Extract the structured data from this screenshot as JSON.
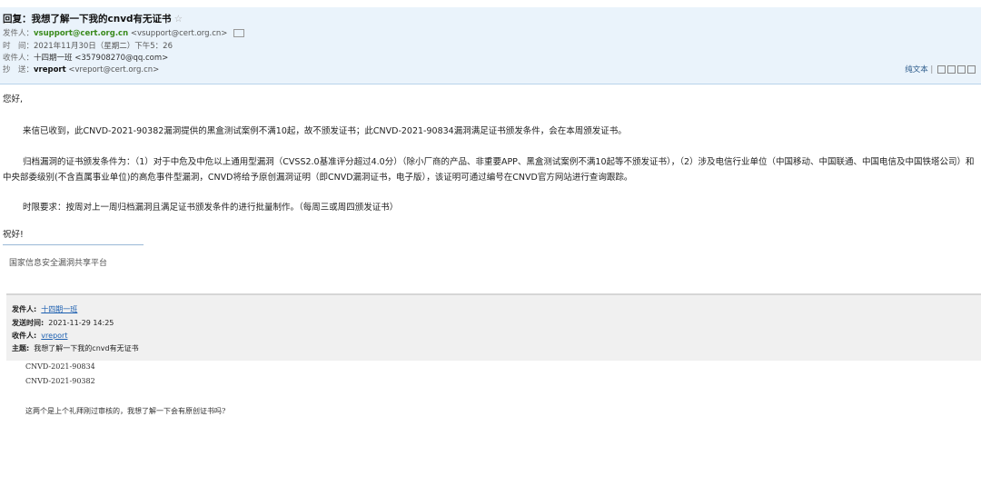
{
  "header": {
    "subject": "回复：我想了解一下我的cnvd有无证书",
    "star": "☆",
    "from_label": "发件人：",
    "from_name": "vsupport@cert.org.cn",
    "from_addr": "<vsupport@cert.org.cn>",
    "time_label": "时　间：",
    "time_value": "2021年11月30日（星期二）下午5：26",
    "to_label": "收件人：",
    "to_value": "十四期一班 <357908270@qq.com>",
    "cc_label": "抄　送：",
    "cc_name": "vreport",
    "cc_addr": "<vreport@cert.org.cn>",
    "plain_text": "纯文本",
    "separator": "|"
  },
  "body": {
    "greeting": "您好,",
    "para1": "来信已收到，此CNVD-2021-90382漏洞提供的黑盒测试案例不满10起，故不颁发证书；此CNVD-2021-90834漏洞满足证书颁发条件，会在本周颁发证书。",
    "para2": "归档漏洞的证书颁发条件为：（1）对于中危及中危以上通用型漏洞（CVSS2.0基准评分超过4.0分）（除小厂商的产品、非重要APP、黑盒测试案例不满10起等不颁发证书），（2）涉及电信行业单位（中国移动、中国联通、中国电信及中国铁塔公司）和中央部委级别(不含直属事业单位)的高危事件型漏洞，CNVD将给予原创漏洞证明（即CNVD漏洞证书，电子版），该证明可通过编号在CNVD官方网站进行查询跟踪。",
    "para3": "时限要求：按周对上一周归档漏洞且满足证书颁发条件的进行批量制作。（每周三或周四颁发证书）",
    "closing": "祝好!",
    "signature": "国家信息安全漏洞共享平台"
  },
  "quoted": {
    "from_label": "发件人:",
    "from_value": "十四期一班",
    "sent_label": "发送时间:",
    "sent_value": "2021-11-29 14:25",
    "to_label": "收件人:",
    "to_value": "vreport",
    "subject_label": "主题:",
    "subject_value": "我想了解一下我的cnvd有无证书",
    "line1": "CNVD-2021-90834",
    "line2": "CNVD-2021-90382",
    "line3": "这两个是上个礼拜刚过审核的，我想了解一下会有原创证书吗?"
  }
}
